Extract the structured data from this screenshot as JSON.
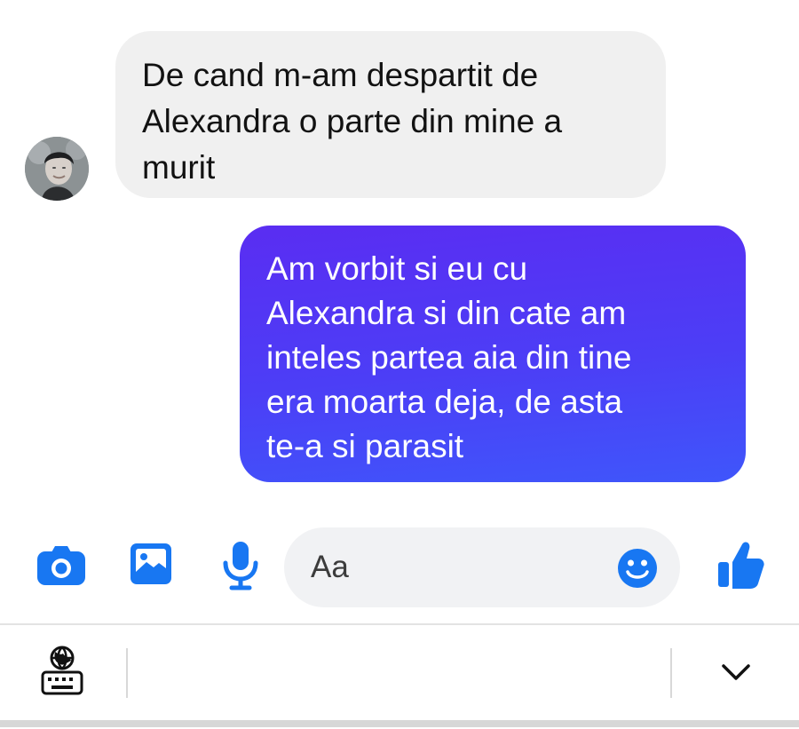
{
  "conversation": {
    "received_message": "De cand m-am despartit de\nAlexandra o parte din mine a\nmurit",
    "sent_message": "Am vorbit si eu cu\nAlexandra si din cate am\ninteles partea aia din tine\nera moarta deja, de asta\nte-a si parasit"
  },
  "composer": {
    "placeholder": "Aa",
    "icons": {
      "camera": "camera-icon",
      "gallery": "gallery-icon",
      "microphone": "microphone-icon",
      "emoji": "emoji-icon",
      "like": "thumbs-up-icon"
    }
  },
  "keyboard_bar": {
    "icons": {
      "switch_keyboard": "globe-keyboard-icon",
      "hide_keyboard": "chevron-down-icon"
    }
  },
  "colors": {
    "sent_bubble_start": "#5a2df2",
    "sent_bubble_end": "#3f56fb",
    "received_bubble": "#f0f0f0",
    "accent_blue": "#1877f2"
  }
}
